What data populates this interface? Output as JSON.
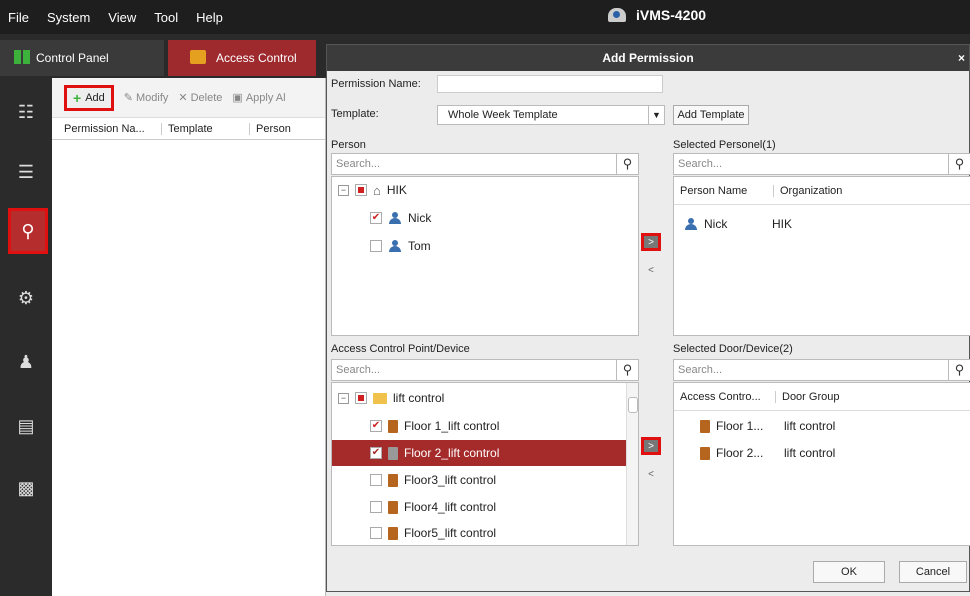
{
  "menu": [
    "File",
    "System",
    "View",
    "Tool",
    "Help"
  ],
  "app_title": "iVMS-4200",
  "tabs": [
    {
      "label": "Control Panel",
      "icon": "grid-icon"
    },
    {
      "label": "Access Control",
      "icon": "door-icon"
    }
  ],
  "toolbar": {
    "add": "Add",
    "modify": "Modify",
    "delete": "Delete",
    "apply": "Apply Al"
  },
  "table_headers": [
    "Permission Na...",
    "Template",
    "Person"
  ],
  "dialog": {
    "title": "Add Permission",
    "close": "×",
    "permission_name_label": "Permission Name:",
    "permission_name_value": "",
    "template_label": "Template:",
    "template_value": "Whole Week Template",
    "add_template": "Add Template",
    "person_label": "Person",
    "person_search_placeholder": "Search...",
    "selected_personel_label": "Selected Personel(1)",
    "selected_search_placeholder": "Search...",
    "person_tree": {
      "root": "HIK",
      "children": [
        {
          "name": "Nick",
          "checked": true
        },
        {
          "name": "Tom",
          "checked": false
        }
      ]
    },
    "selected_person_headers": [
      "Person Name",
      "Organization"
    ],
    "selected_persons": [
      {
        "name": "Nick",
        "org": "HIK"
      }
    ],
    "acp_label": "Access Control Point/Device",
    "acp_search_placeholder": "Search...",
    "acp_tree": {
      "root": "lift control",
      "children": [
        {
          "name": "Floor 1_lift control",
          "checked": true,
          "selected": false
        },
        {
          "name": "Floor 2_lift control",
          "checked": true,
          "selected": true
        },
        {
          "name": "Floor3_lift control",
          "checked": false,
          "selected": false
        },
        {
          "name": "Floor4_lift control",
          "checked": false,
          "selected": false
        },
        {
          "name": "Floor5_lift control",
          "checked": false,
          "selected": false
        }
      ]
    },
    "selected_door_label": "Selected Door/Device(2)",
    "selected_door_search_placeholder": "Search...",
    "selected_door_headers": [
      "Access Contro...",
      "Door Group"
    ],
    "selected_doors": [
      {
        "name": "Floor 1...",
        "group": "lift control"
      },
      {
        "name": "Floor 2...",
        "group": "lift control"
      }
    ],
    "arrow_right": ">",
    "arrow_left": "<",
    "ok": "OK",
    "cancel": "Cancel"
  },
  "colors": {
    "accent": "#9e2a2e",
    "highlight": "#e01010",
    "selected_row": "#a52a2a"
  }
}
